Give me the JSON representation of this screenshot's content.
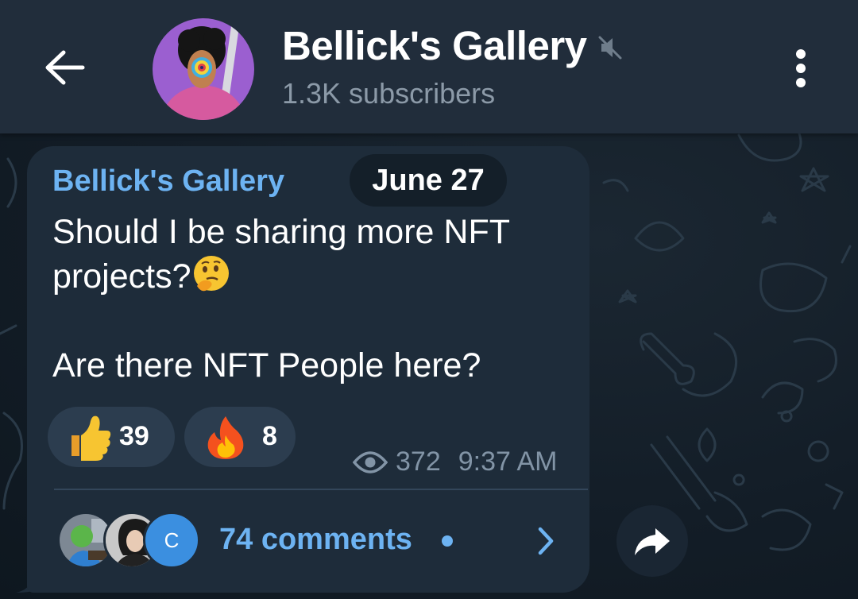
{
  "header": {
    "channel_name": "Bellick's Gallery",
    "subscribers": "1.3K subscribers",
    "back_icon": "arrow-left-icon",
    "mute_icon": "speaker-muted-icon",
    "menu_icon": "more-vertical-icon"
  },
  "post": {
    "sender": "Bellick's Gallery",
    "date": "June 27",
    "text_lines": [
      "Should I be sharing more NFT",
      "projects?",
      "",
      "Are there NFT People here?"
    ],
    "text_emoji": "thinking-face-emoji",
    "reactions": [
      {
        "emoji": "thumbs-up-emoji",
        "count": "39"
      },
      {
        "emoji": "fire-emoji",
        "count": "8"
      }
    ],
    "views": "372",
    "time": "9:37 AM"
  },
  "comments": {
    "label": "74 comments",
    "avatar_letter": "C",
    "arrow_icon": "chevron-right-icon"
  },
  "share": {
    "icon": "share-arrow-icon"
  },
  "colors": {
    "header_bg": "#212d3b",
    "bubble_bg": "#1e2c3a",
    "accent": "#6db3f2",
    "muted_text": "#8c9aa8",
    "reaction_bg": "#2c3d4f"
  }
}
